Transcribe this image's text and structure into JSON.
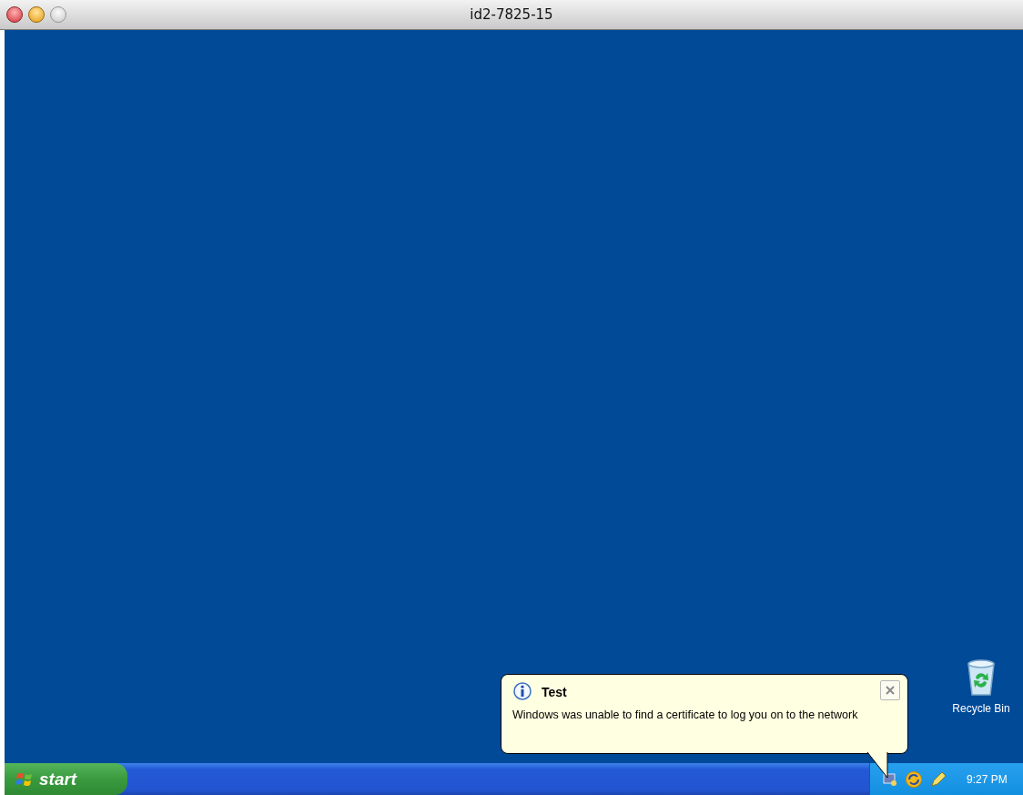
{
  "window": {
    "title": "id2-7825-15"
  },
  "desktop_icons": [
    {
      "label": "Recycle Bin"
    }
  ],
  "balloon": {
    "title": "Test",
    "message": "Windows was unable to find a certificate to log you on to the network"
  },
  "taskbar": {
    "start_label": "start",
    "clock": "9:27 PM"
  }
}
